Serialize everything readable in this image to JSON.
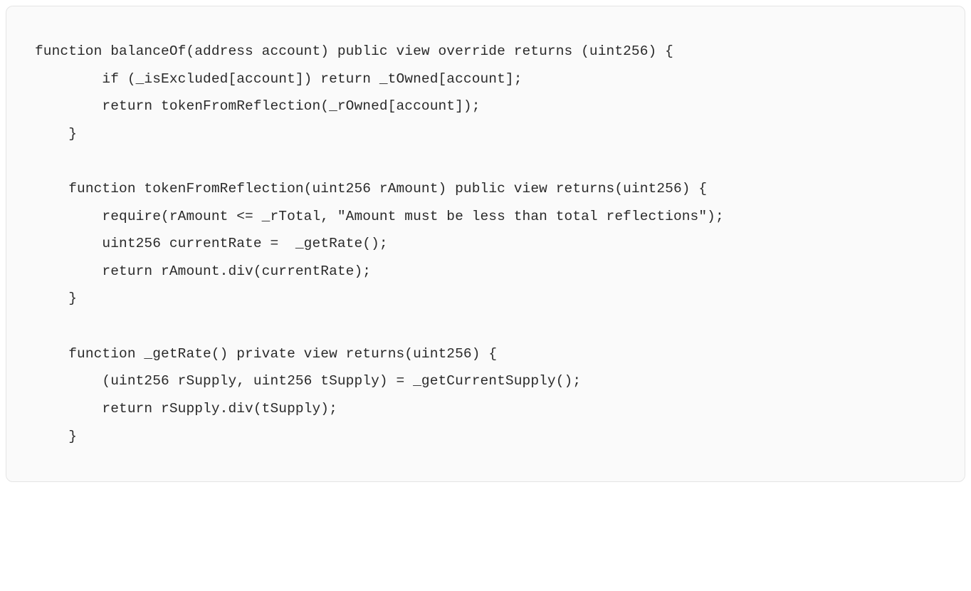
{
  "code": {
    "content": "function balanceOf(address account) public view override returns (uint256) {\n        if (_isExcluded[account]) return _tOwned[account];\n        return tokenFromReflection(_rOwned[account]);\n    }\n\n    function tokenFromReflection(uint256 rAmount) public view returns(uint256) {\n        require(rAmount <= _rTotal, \"Amount must be less than total reflections\");\n        uint256 currentRate =  _getRate();\n        return rAmount.div(currentRate);\n    }\n\n    function _getRate() private view returns(uint256) {\n        (uint256 rSupply, uint256 tSupply) = _getCurrentSupply();\n        return rSupply.div(tSupply);\n    }"
  }
}
